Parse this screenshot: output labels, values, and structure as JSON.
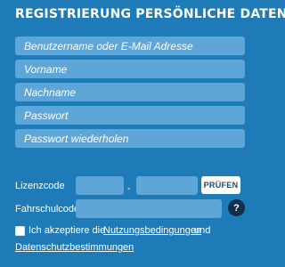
{
  "form": {
    "title": "REGISTRIERUNG PERSÖNLICHE DATEN",
    "fields": [
      {
        "placeholder": "Benutzername oder E-Mail Adresse",
        "value": ""
      },
      {
        "placeholder": "Vorname",
        "value": ""
      },
      {
        "placeholder": "Nachname",
        "value": ""
      },
      {
        "placeholder": "Passwort",
        "value": ""
      },
      {
        "placeholder": "Passwort wiederholen",
        "value": ""
      }
    ]
  },
  "license": {
    "label": "Lizenzcode",
    "separator": "-",
    "check_label": "PRÜFEN"
  },
  "school": {
    "label": "Fahrschulcode",
    "help_glyph": "?"
  },
  "terms": {
    "checked": false,
    "prefix": "Ich akzeptiere die",
    "terms_link": "Nutzungsbedingungen",
    "conjunction": "und",
    "privacy_link": "Datenschutzbestimmungen"
  },
  "colors": {
    "background": "#1f7ab8",
    "input_fill": "#5ea6d8",
    "help_icon": "#0f2f4d",
    "button_text": "#1c4b6b"
  }
}
